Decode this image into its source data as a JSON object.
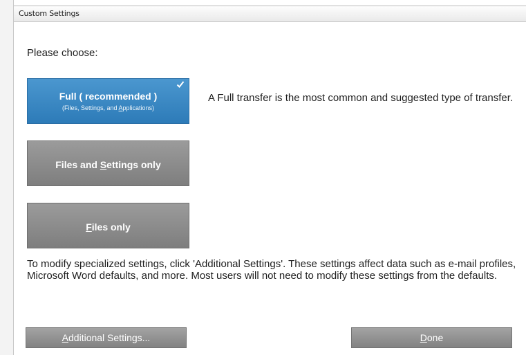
{
  "window": {
    "title": "Custom Settings"
  },
  "prompt": "Please choose:",
  "choices": [
    {
      "label_pre": "",
      "label_key": "",
      "label_post": "Full ( recommended )",
      "sub_pre": "(Files, Settings, and ",
      "sub_key": "A",
      "sub_post": "pplications)",
      "selected": true
    },
    {
      "label_pre": "Files and ",
      "label_key": "S",
      "label_post": "ettings only",
      "selected": false
    },
    {
      "label_pre": "",
      "label_key": "F",
      "label_post": "iles only",
      "selected": false
    }
  ],
  "description": "A Full transfer is the most common and suggested type of transfer.",
  "info": "To modify specialized settings, click 'Additional Settings'. These settings affect data such as e-mail profiles, Microsoft Word defaults, and more. Most users will not need to modify these settings from the defaults.",
  "buttons": {
    "additional": {
      "key": "A",
      "rest": "dditional Settings..."
    },
    "done": {
      "key": "D",
      "rest": "one"
    }
  },
  "colors": {
    "selected_accent": "#3a88c4",
    "unselected_button": "#8c8c8c"
  },
  "icons": {
    "selected_mark": "check-icon"
  }
}
